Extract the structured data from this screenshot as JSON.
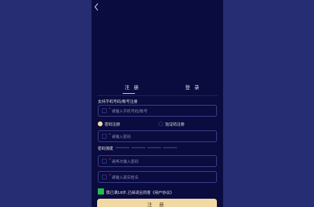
{
  "header": {
    "back_icon": "chevron-left-icon"
  },
  "tabs": [
    {
      "label": "注 册",
      "active": true
    },
    {
      "label": "登 录",
      "active": false
    }
  ],
  "account": {
    "label": "支持手机号码/账号注册",
    "placeholder": "请输入手机号码/账号"
  },
  "register_method": {
    "options": [
      {
        "label": "密码注册",
        "selected": true
      },
      {
        "label": "验证码注册",
        "selected": false
      }
    ]
  },
  "password": {
    "placeholder": "请输入密码"
  },
  "strength": {
    "label": "密码强度",
    "level": 0
  },
  "password_confirm": {
    "placeholder": "请再次输入密码"
  },
  "real_name": {
    "placeholder": "请输入真实姓名"
  },
  "agreement": {
    "checked": true,
    "text": "我已满18岁,已阅读且同意",
    "link": "《用户协议》"
  },
  "submit": {
    "label": "注 册"
  },
  "colors": {
    "page_bg": "#262d72",
    "panel_bg": "#0a0b3e",
    "accent": "#f1d9a6",
    "check_green": "#1fbf4b",
    "required_red": "#d44a4a"
  }
}
